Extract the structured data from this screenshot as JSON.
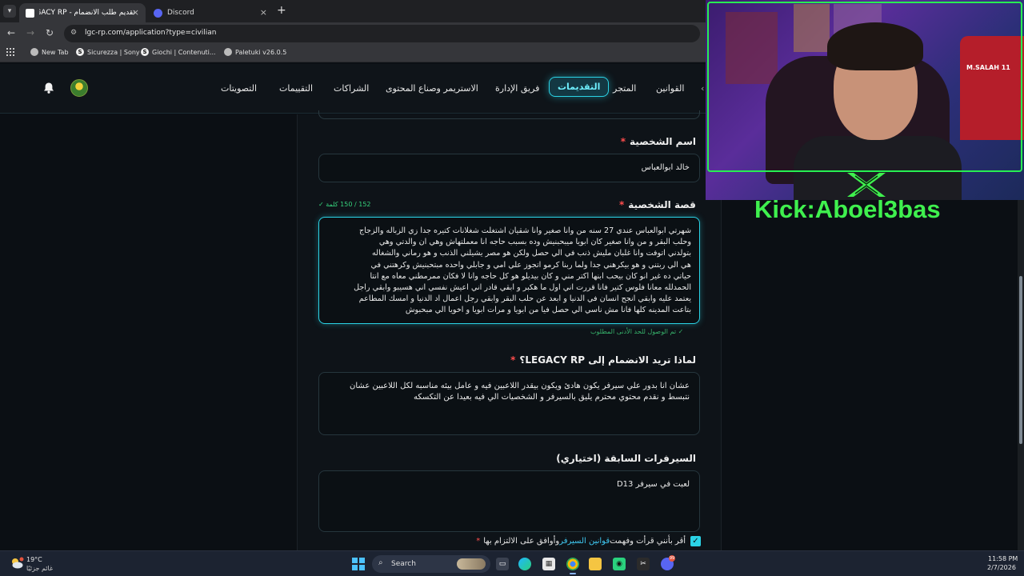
{
  "browser": {
    "tabs": [
      {
        "title": "تقديم طلب الانضمام - LEGACY RP",
        "active": true
      },
      {
        "title": "Discord",
        "active": false
      }
    ],
    "tab_close": "×",
    "new_tab": "+",
    "url": "lgc-rp.com/application?type=civilian",
    "bookmarks": [
      {
        "label": "New Tab",
        "icon": "globe-icon"
      },
      {
        "label": "Sicurezza | Sony",
        "icon": "s-icon"
      },
      {
        "label": "Giochi | Contenuti...",
        "icon": "s-icon"
      },
      {
        "label": "Paletuki v26.0.5",
        "icon": "globe-icon"
      }
    ]
  },
  "site_nav": {
    "items": [
      {
        "label": "القوانين"
      },
      {
        "label": "المتجر"
      },
      {
        "label": "التقديمات",
        "active": true
      },
      {
        "label": "فريق الإدارة"
      },
      {
        "label": "الاستريمر وصناع المحتوى"
      },
      {
        "label": "الشراكات"
      },
      {
        "label": "التقييمات"
      },
      {
        "label": "التصويتات"
      }
    ]
  },
  "form": {
    "name_label": "اسم الشخصية",
    "name_value": "خالد ابوالعباس",
    "story_label": "قصة الشخصية",
    "story_counter": "152 / 150 كلمة ✓",
    "story_lines": [
      "شهرتي ابوالعباس  عندي 27 سنه من وانا صغير وانا شقيان اشتغلت شغلانات كتيره جدا زي الزباله والزجاج",
      "وحلب البقر  و من وانا صغير كان ابويا ميبحبنيش وده بسبب حاجه انا معملتهاش وهي ان والدتي وهي",
      "بتولدني اتوفت وانا غلبان مليش ذنب في الي حصل ولكن هو مصر يشيلني الذنب و هو رماني والشغاله",
      "هي الي ربتني و هو بيكرهني جدا  ولما ربنا كرمو اتجوز علي امي و جابلي واحده مبتحبنيش وكرهتني في",
      "حياتي ده غير انو كان بيحب ابنها  اكتر مني و كان بيديلو هو كل حاجه وانا لا فكان ممرمطني معاه مع انتا",
      "الحمدلله معانا فلوس كتير فانا قررت اني اول ما هكبر و ابقي قادر اني اعيش نفسي اني هسيبو وابقي راجل",
      "يعتمد عليه وابقي انجح  انسان في الدنيا و ابعد عن  حلب البقر وابقي رجل اعمال اد الدنيا و امسك المطاعم",
      "بتاعت المدينه كلها فانا مش ناسي الي حصل فيا من ابويا و مرات ابويا و اخويا الي مبحبوش"
    ],
    "story_min_met": "✓ تم الوصول للحد الأدنى المطلوب",
    "why_label": "لماذا تريد الانضمام إلى LEGACY RP؟",
    "why_lines": [
      "عشان انا بدور علي سيرفر يكون هادئ ويكون بيقدر اللاعبين فيه و عامل بيئه مناسبه  لكل اللاعبين  عشان",
      "نتبسط و نقدم محتوي محترم يليق بالسيرفر  و الشخصيات الي فيه  بعيدا عن التكسكه"
    ],
    "servers_label": "السيرفرات السابقة (اختياري)",
    "servers_value": "لعبت في سيرفر D13",
    "agree_prefix": "أقر بأنني قرأت وفهمت ",
    "agree_link": "قوانين السيرفر",
    "agree_suffix": " وأوافق على الالتزام بها",
    "required_mark": "*"
  },
  "stream": {
    "kick_text": "Kick:Aboel3bas",
    "jersey_text": "M.SALAH 11"
  },
  "taskbar": {
    "weather_temp": "19°C",
    "weather_desc": "غائم جزئيًا",
    "search_label": "Search",
    "notification_count": "99",
    "time": "11:58 PM",
    "date": "2/7/2026"
  },
  "colors": {
    "accent": "#2bd3e6",
    "required": "#ff4d4d",
    "success": "#36d27c",
    "stream_green": "#3ff04e"
  }
}
